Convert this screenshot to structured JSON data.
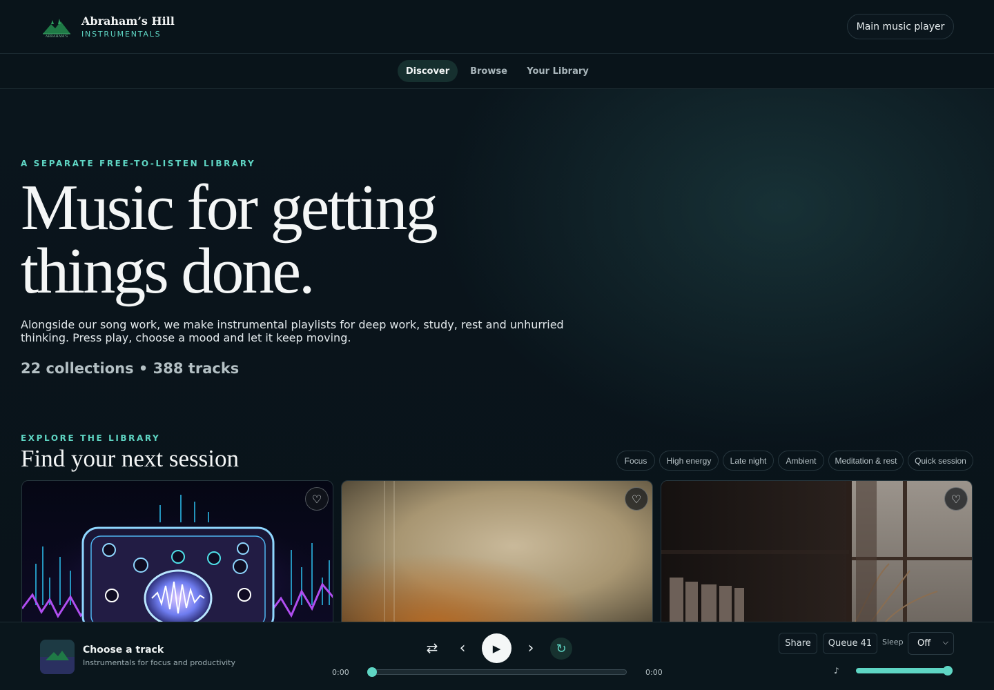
{
  "brand": {
    "name": "Abraham’s Hill",
    "subtitle": "INSTRUMENTALS",
    "logo_text": "ABRAHAM'S"
  },
  "header": {
    "main_player_label": "Main music player"
  },
  "nav": {
    "tabs": [
      "Discover",
      "Browse",
      "Your Library"
    ],
    "active": "Discover"
  },
  "hero": {
    "eyebrow": "A SEPARATE FREE-TO-LISTEN LIBRARY",
    "title_line1": "Music for getting",
    "title_line2": "things done.",
    "description": "Alongside our song work, we make instrumental playlists for deep work, study, rest and unhurried thinking. Press play, choose a mood and let it keep moving.",
    "stats": "22 collections • 388 tracks"
  },
  "explore": {
    "eyebrow": "EXPLORE THE LIBRARY",
    "title": "Find your next session",
    "filters": [
      "Focus",
      "High energy",
      "Late night",
      "Ambient",
      "Meditation & rest",
      "Quick session"
    ],
    "favorite_icon": "♡"
  },
  "player": {
    "track_title": "Choose a track",
    "track_subtitle": "Instrumentals for focus and productivity",
    "elapsed": "0:00",
    "duration": "0:00",
    "progress": 0,
    "share_label": "Share",
    "queue_label": "Queue 41",
    "sleep_label": "Sleep",
    "sleep_value": "Off",
    "volume": 1.0,
    "icons": {
      "shuffle": "⇄",
      "prev": "‹",
      "play": "▶",
      "next": "›",
      "repeat": "↻",
      "volume": "♪"
    }
  },
  "colors": {
    "accent": "#5fd6c4",
    "background": "#0a141b",
    "active_tab": "#16302f"
  }
}
